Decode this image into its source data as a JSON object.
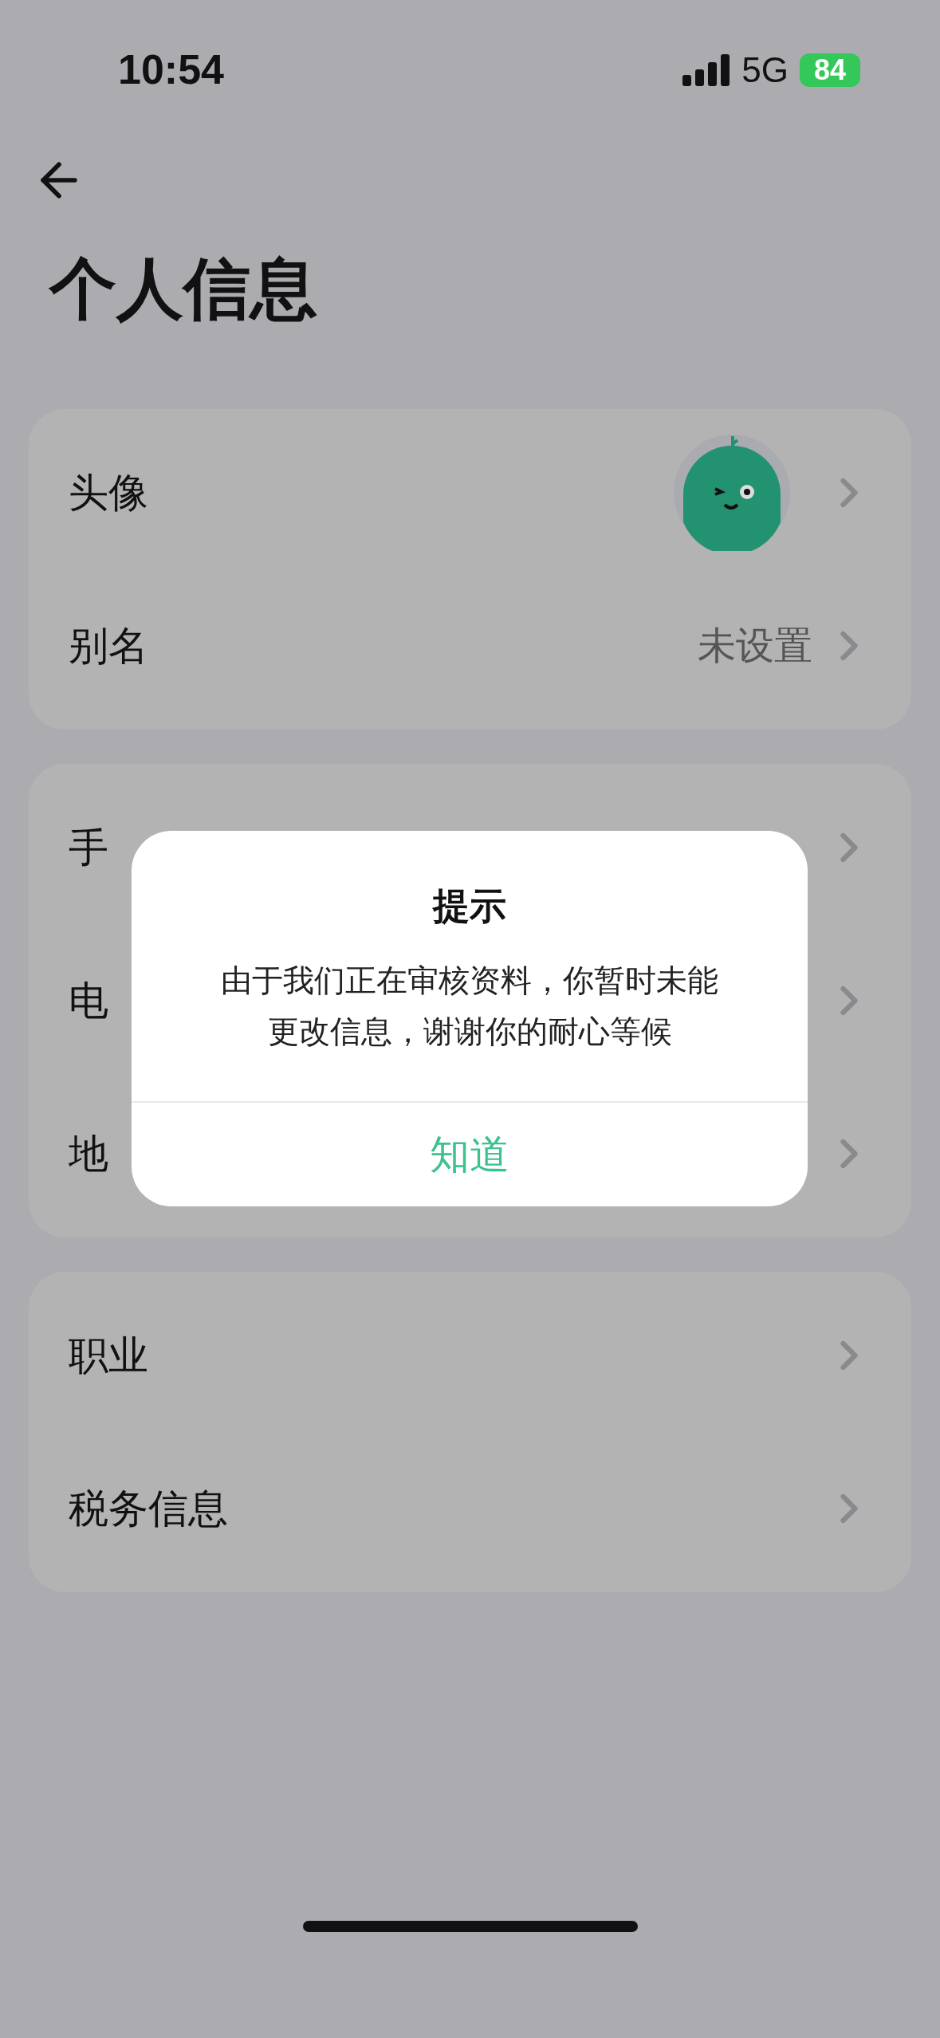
{
  "status_bar": {
    "time": "10:54",
    "network": "5G",
    "battery": "84"
  },
  "title": "个人信息",
  "sections": [
    {
      "rows": [
        {
          "kind": "avatar",
          "label": "头像"
        },
        {
          "kind": "value",
          "label": "别名",
          "value": "未设置"
        }
      ]
    },
    {
      "rows": [
        {
          "kind": "value",
          "label": "手"
        },
        {
          "kind": "value",
          "label": "电"
        },
        {
          "kind": "value",
          "label": "地"
        }
      ]
    },
    {
      "rows": [
        {
          "kind": "value",
          "label": "职业"
        },
        {
          "kind": "value",
          "label": "税务信息"
        }
      ]
    }
  ],
  "dialog": {
    "title": "提示",
    "message_lines": [
      "由于我们正在审核资料，你暂时未能",
      "更改信息，谢谢你的耐心等候"
    ],
    "button": "知道"
  }
}
